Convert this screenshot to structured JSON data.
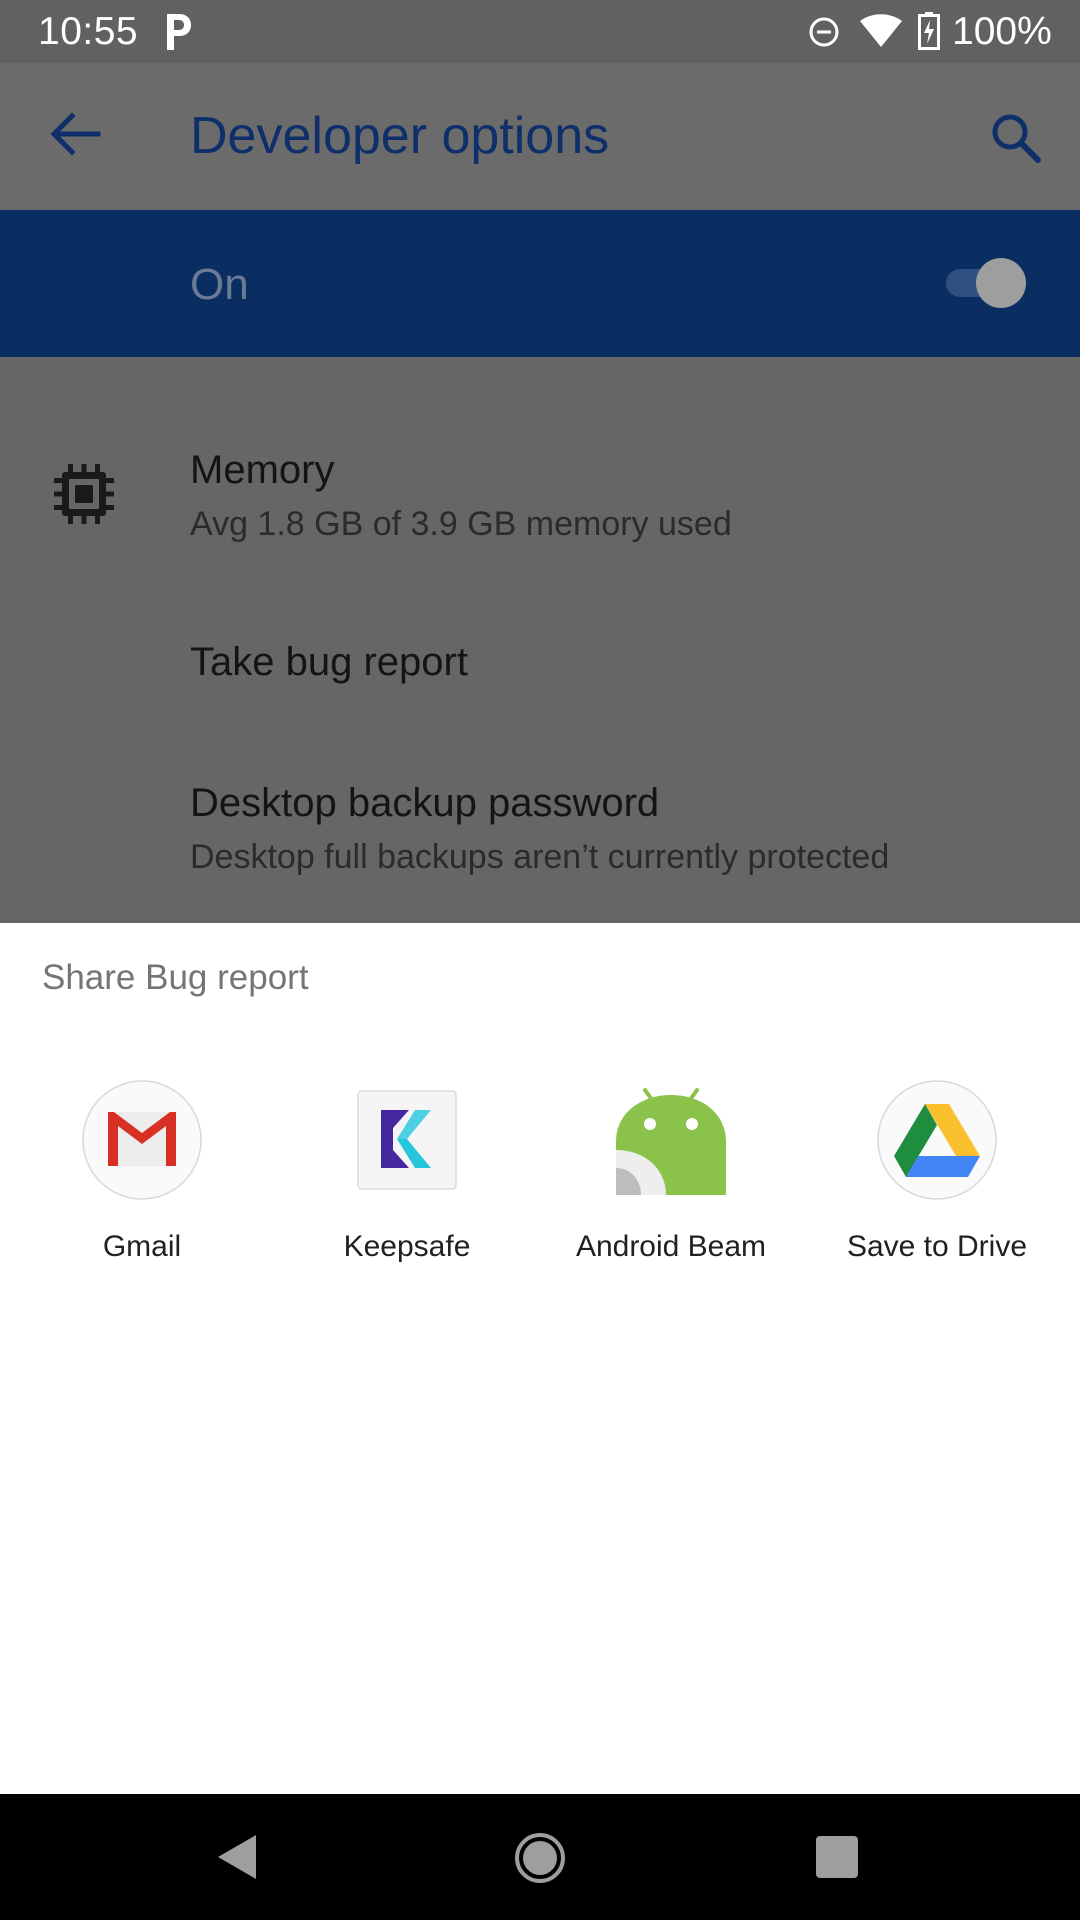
{
  "status_bar": {
    "time": "10:55",
    "battery_percent": "100%"
  },
  "toolbar": {
    "title": "Developer options"
  },
  "master_switch": {
    "label": "On",
    "enabled": true
  },
  "settings": {
    "memory": {
      "title": "Memory",
      "subtitle": "Avg 1.8 GB of 3.9 GB memory used"
    },
    "bug_report": {
      "title": "Take bug report"
    },
    "backup": {
      "title": "Desktop backup password",
      "subtitle": "Desktop full backups aren’t currently protected"
    }
  },
  "share_sheet": {
    "title": "Share Bug report",
    "apps": [
      {
        "label": "Gmail",
        "icon": "gmail-icon"
      },
      {
        "label": "Keepsafe",
        "icon": "keepsafe-icon"
      },
      {
        "label": "Android Beam",
        "icon": "android-beam-icon"
      },
      {
        "label": "Save to Drive",
        "icon": "drive-icon"
      }
    ]
  },
  "colors": {
    "accent": "#0b2e62",
    "scrim_gray": "#666666",
    "status_bar": "#616161",
    "nav_bar": "#000000"
  }
}
